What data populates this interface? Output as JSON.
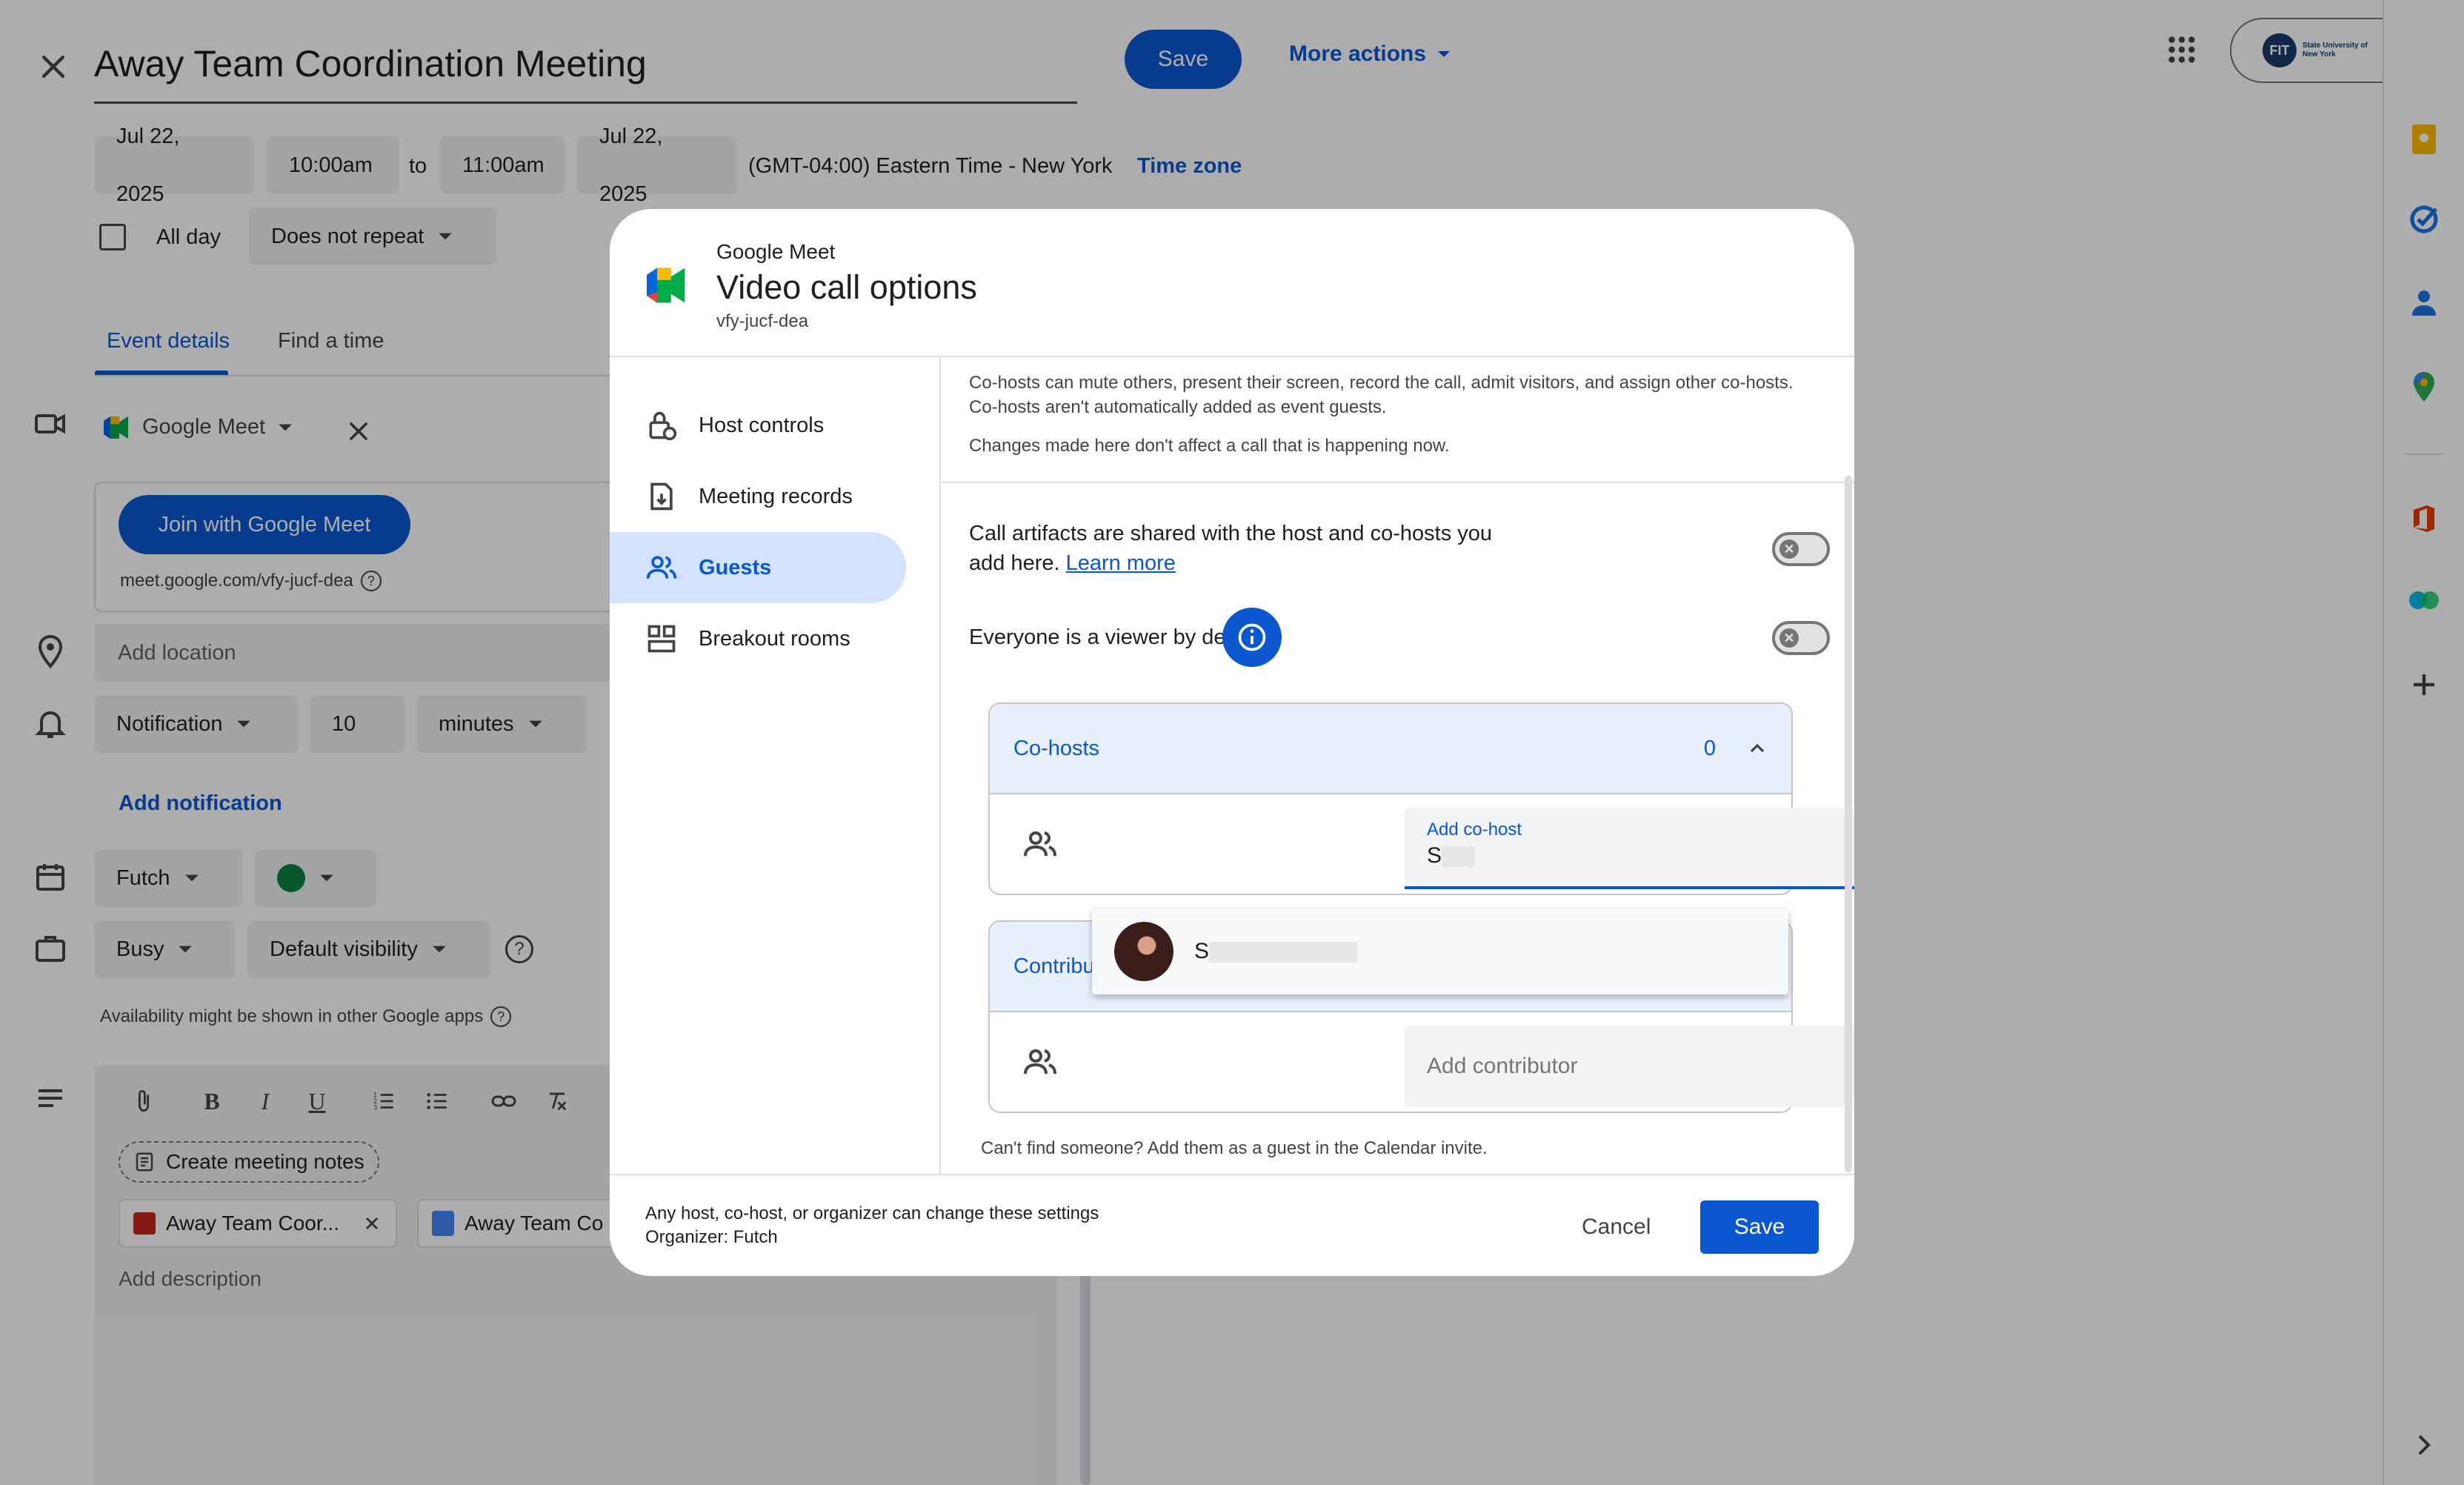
{
  "event": {
    "title": "Away Team Coordination Meeting",
    "save_label": "Save",
    "more_actions_label": "More actions",
    "start_date": "Jul 22, 2025",
    "start_time": "10:00am",
    "to_label": "to",
    "end_time": "11:00am",
    "end_date": "Jul 22, 2025",
    "timezone_text": "(GMT-04:00) Eastern Time - New York",
    "timezone_link": "Time zone",
    "all_day_label": "All day",
    "repeat_value": "Does not repeat",
    "tabs": [
      {
        "label": "Event details",
        "active": true
      },
      {
        "label": "Find a time",
        "active": false
      }
    ],
    "conferencing": "Google Meet",
    "join_label": "Join with Google Meet",
    "meet_link": "meet.google.com/vfy-jucf-dea",
    "location_placeholder": "Add location",
    "notification_type": "Notification",
    "notification_amount": "10",
    "notification_unit": "minutes",
    "add_notification_label": "Add notification",
    "calendar_name": "Futch",
    "event_color": "#0b8043",
    "availability": "Busy",
    "visibility": "Default visibility",
    "availability_note": "Availability might be shown in other Google apps",
    "meeting_notes_label": "Create meeting notes",
    "attachments": [
      "Away Team Coor...",
      "Away Team Co"
    ],
    "description_placeholder": "Add description",
    "account_logo_text": "FIT",
    "account_logo_sub": "State University of New York"
  },
  "dialog": {
    "subtitle": "Google Meet",
    "title": "Video call options",
    "meeting_code": "vfy-jucf-dea",
    "nav": [
      {
        "label": "Host controls",
        "icon": "lock-person-icon",
        "active": false
      },
      {
        "label": "Meeting records",
        "icon": "record-icon",
        "active": false
      },
      {
        "label": "Guests",
        "icon": "people-icon",
        "active": true
      },
      {
        "label": "Breakout rooms",
        "icon": "grid-icon",
        "active": false
      }
    ],
    "intro_line1": "Co-hosts can mute others, present their screen, record the call, admit visitors, and assign other co-hosts. Co-hosts aren't automatically added as event guests.",
    "intro_line2": "Changes made here don't affect a call that is happening now.",
    "artifacts_text": "Call artifacts are shared with the host and co-hosts you add here.",
    "learn_more": "Learn more",
    "viewer_text": "Everyone is a viewer by default",
    "cohosts_label": "Co-hosts",
    "cohosts_count": "0",
    "add_cohost_label": "Add co-host",
    "add_cohost_value": "S",
    "suggestion_initial": "S",
    "contributors_label": "Contribu",
    "add_contributor_placeholder": "Add contributor",
    "cant_find": "Can't find someone? Add them as a guest in the Calendar invite.",
    "footer_line1": "Any host, co-host, or organizer can change these settings",
    "footer_line2": "Organizer: Futch",
    "cancel_label": "Cancel",
    "save_label": "Save",
    "toggles": {
      "artifacts_on": false,
      "viewer_on": false
    }
  },
  "colors": {
    "accent": "#0b57d0",
    "nav_active_bg": "#d3e3fd",
    "scrim": "rgba(0,0,0,0.32)"
  }
}
